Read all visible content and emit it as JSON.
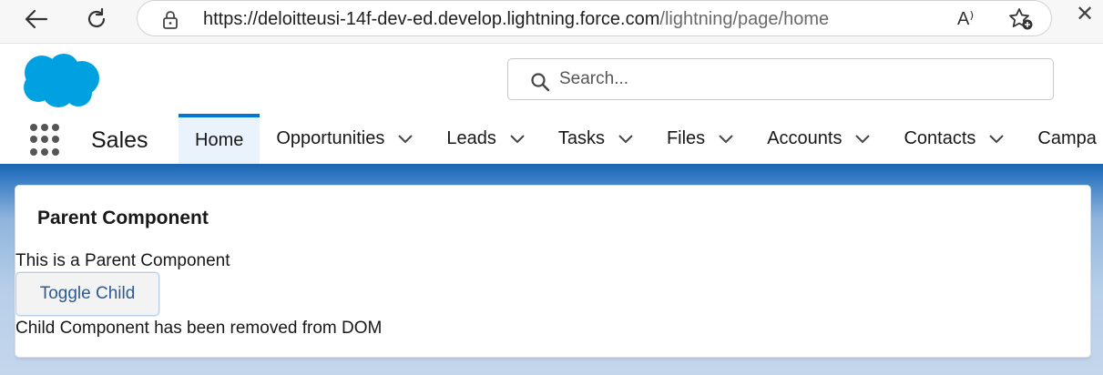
{
  "browser": {
    "url_host": "https://deloitteusi-14f-dev-ed.develop.lightning.force.com",
    "url_path": "/lightning/page/home",
    "read_aloud_label": "A⁾"
  },
  "header": {
    "search_placeholder": "Search...",
    "app_name": "Sales",
    "brand_color": "#00a1e0",
    "active_tab_color": "#0176d3"
  },
  "nav": {
    "tabs": [
      {
        "label": "Home",
        "active": true,
        "has_menu": false
      },
      {
        "label": "Opportunities",
        "has_menu": true
      },
      {
        "label": "Leads",
        "has_menu": true
      },
      {
        "label": "Tasks",
        "has_menu": true
      },
      {
        "label": "Files",
        "has_menu": true
      },
      {
        "label": "Accounts",
        "has_menu": true
      },
      {
        "label": "Contacts",
        "has_menu": true
      },
      {
        "label": "Campa",
        "has_menu": false
      }
    ]
  },
  "card": {
    "title": "Parent Component",
    "text": "This is a Parent Component",
    "button_label": "Toggle Child",
    "status": "Child Component has been removed from DOM"
  }
}
